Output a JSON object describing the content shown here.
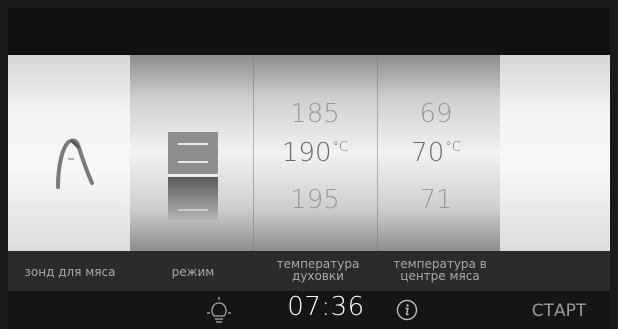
{
  "colors": {
    "background": "#111111",
    "label_bar": "#2b2b2b",
    "label_text": "#a8a8a8",
    "clock_text": "#ffffff",
    "number_dim": "#9a9a9a",
    "number_selected": "#6a6a6a"
  },
  "icons": {
    "probe": "meat-probe-icon",
    "mode": "oven-mode-icon",
    "light": "lamp-icon",
    "info": "info-icon"
  },
  "oven_temp": {
    "prev": "185",
    "selected": "190",
    "unit": "°C",
    "next": "195"
  },
  "core_temp": {
    "prev": "69",
    "selected": "70",
    "unit": "°C",
    "next": "71"
  },
  "labels": {
    "probe": "зонд для мяса",
    "mode": "режим",
    "oven_temp": "температура\nдуховки",
    "core_temp": "температура в\nцентре мяса"
  },
  "bottom": {
    "clock": "07:36",
    "start": "СТАРТ"
  }
}
